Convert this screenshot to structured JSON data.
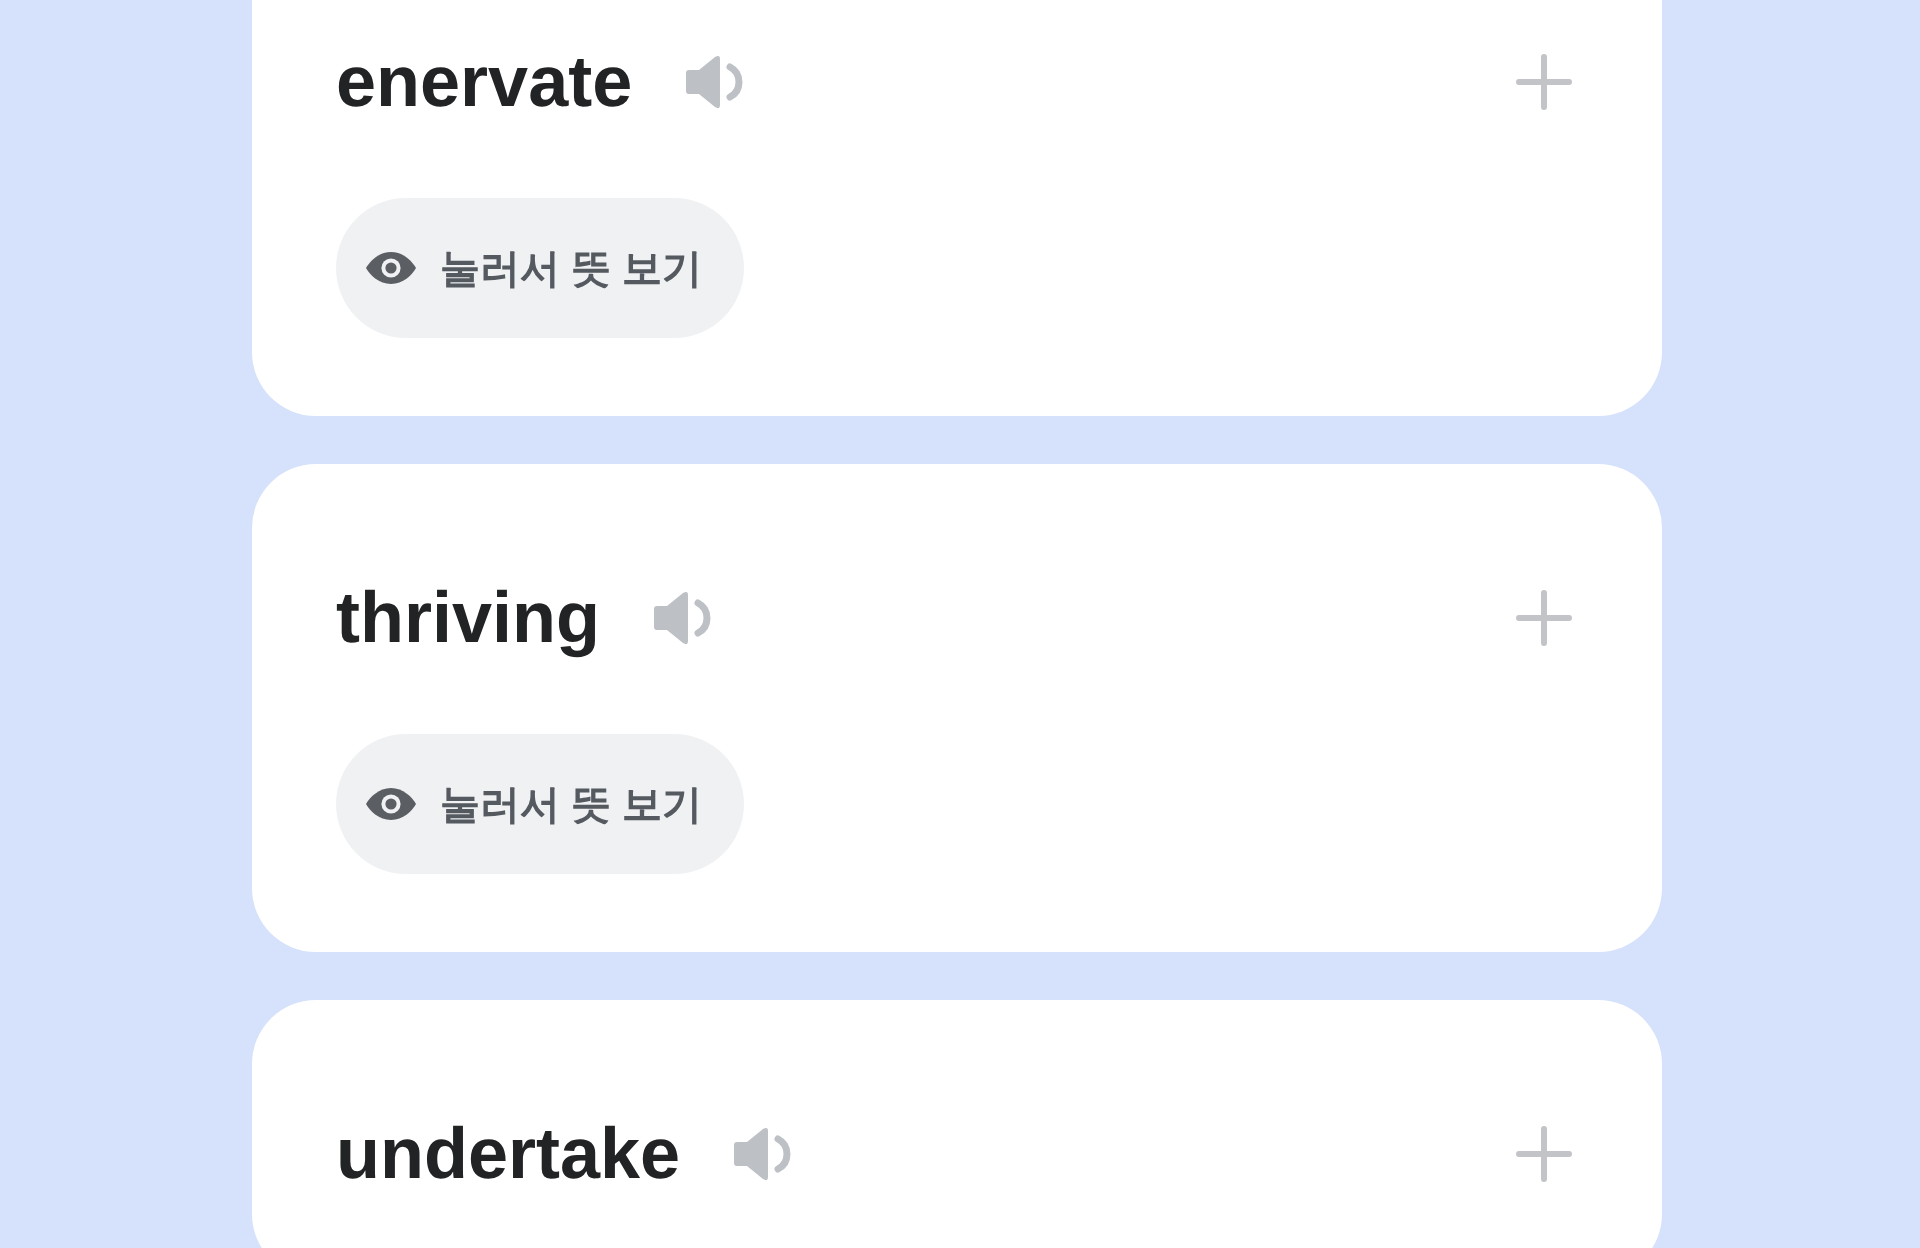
{
  "cards": [
    {
      "word": "enervate",
      "reveal_button": {
        "label": "눌러서 뜻 보기"
      }
    },
    {
      "word": "thriving",
      "reveal_button": {
        "label": "눌러서 뜻 보기"
      }
    },
    {
      "word": "undertake"
    }
  ]
}
